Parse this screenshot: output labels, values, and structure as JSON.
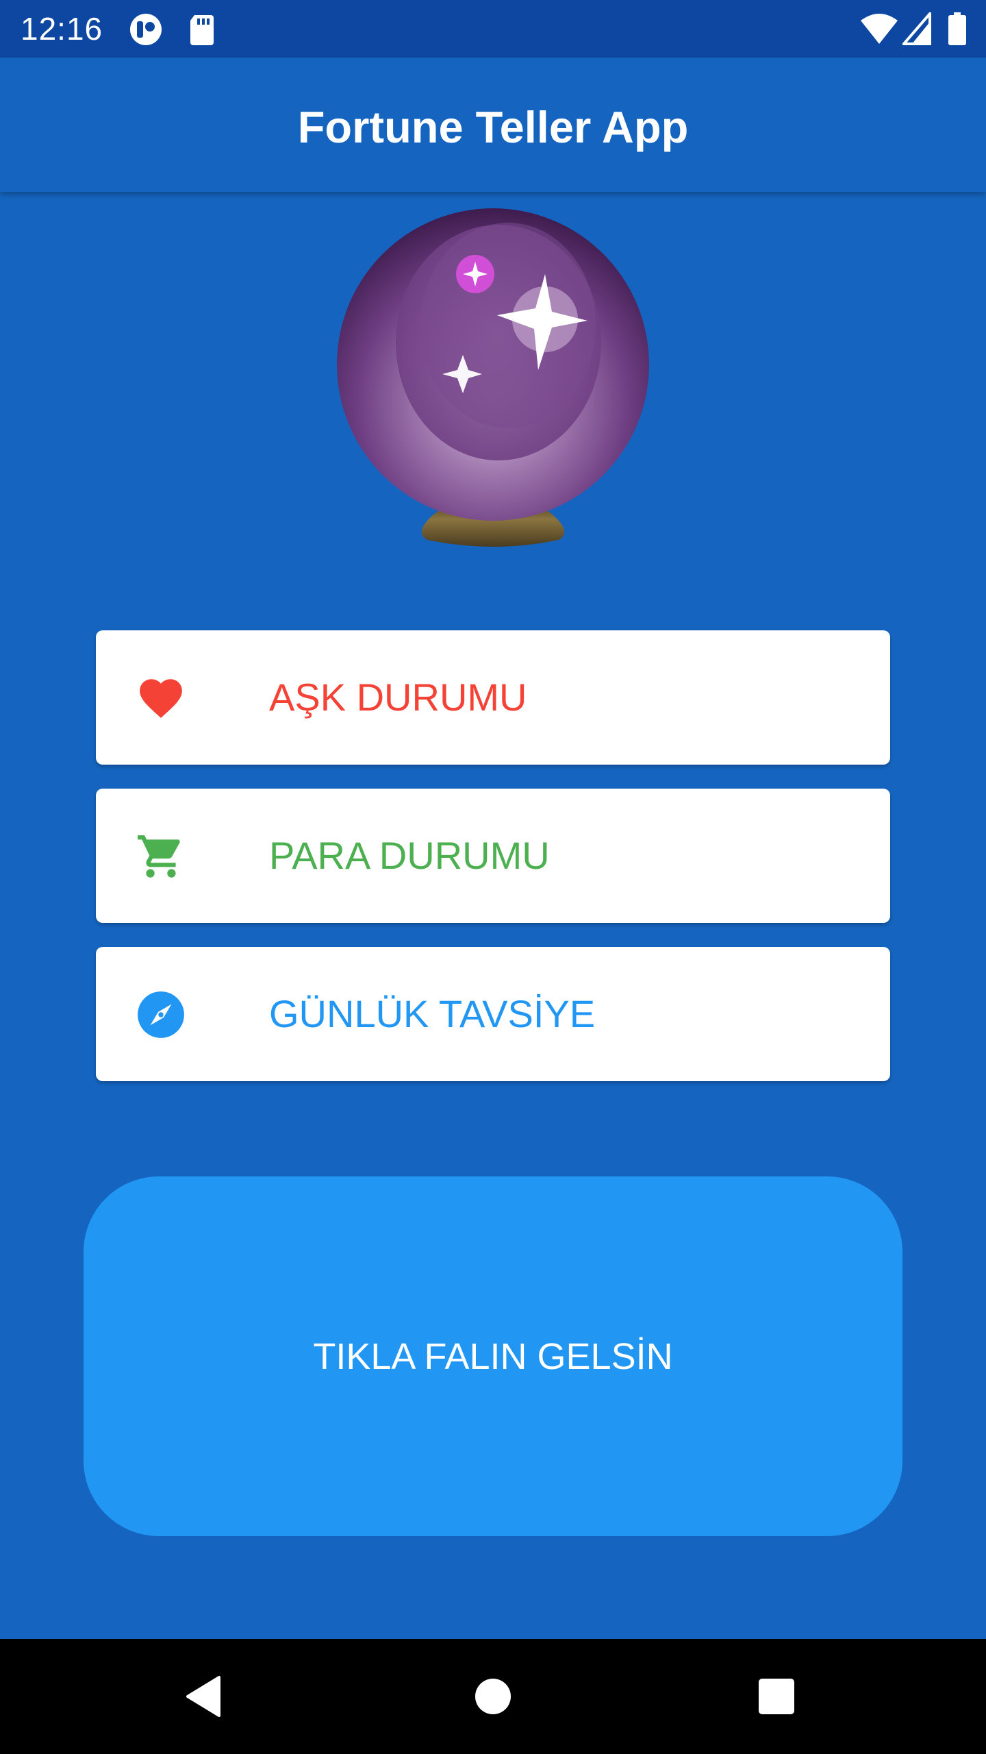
{
  "status_bar": {
    "time": "12:16",
    "icons": [
      "notification-app-icon",
      "sd-card-icon",
      "wifi-icon",
      "cell-signal-icon",
      "battery-icon"
    ]
  },
  "app_bar": {
    "title": "Fortune Teller App"
  },
  "hero": {
    "icon": "crystal-ball-icon"
  },
  "options": [
    {
      "label": "AŞK DURUMU",
      "icon": "heart-icon",
      "color": "#F44336"
    },
    {
      "label": "PARA DURUMU",
      "icon": "shopping-cart-icon",
      "color": "#4CAF50"
    },
    {
      "label": "GÜNLÜK TAVSİYE",
      "icon": "compass-icon",
      "color": "#2196F3"
    }
  ],
  "fortune_button": {
    "label": "TIKLA FALIN GELSİN"
  },
  "nav_bar": {
    "buttons": [
      "back-icon",
      "home-icon",
      "recents-icon"
    ]
  },
  "colors": {
    "background": "#1565C0",
    "status_bar": "#0D47A1",
    "button": "#2196F3"
  }
}
